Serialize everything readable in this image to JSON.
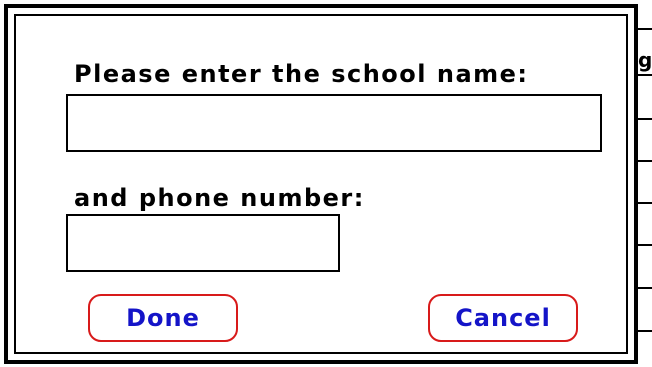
{
  "background_window": {
    "visible_char": "g"
  },
  "dialog": {
    "school_label": "Please enter the school name:",
    "school_value": "",
    "phone_label": "and phone number:",
    "phone_value": "",
    "done_label": "Done",
    "cancel_label": "Cancel"
  },
  "colors": {
    "button_border": "#d81a1a",
    "button_text": "#1414c8",
    "frame": "#000000",
    "background": "#ffffff"
  }
}
